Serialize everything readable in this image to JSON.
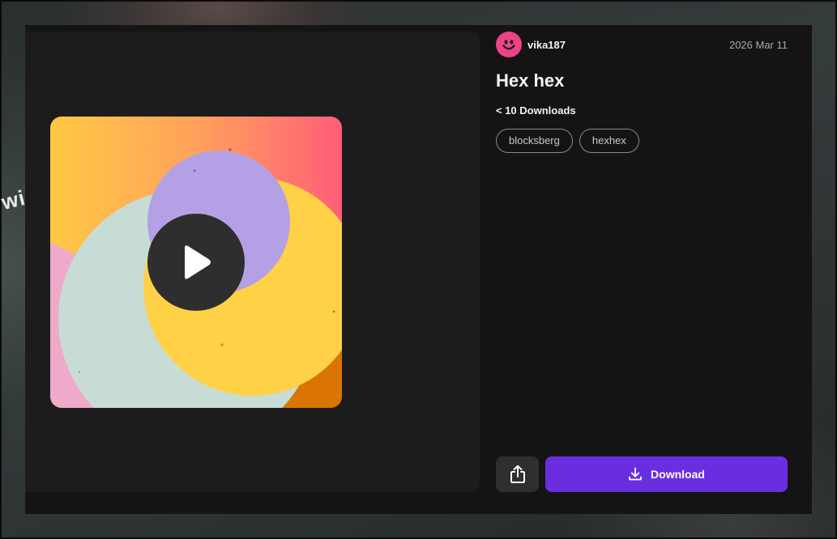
{
  "author": {
    "username": "vika187"
  },
  "post": {
    "date": "2026 Mar 11",
    "title": "Hex hex",
    "downloads": "< 10 Downloads",
    "tags": [
      "blocksberg",
      "hexhex"
    ]
  },
  "actions": {
    "download_label": "Download"
  },
  "icons": {
    "avatar": "smiley-icon",
    "play": "play-icon",
    "share": "share-icon",
    "download": "download-icon"
  },
  "colors": {
    "accent": "#6a2ee0",
    "avatar": "#ec4289",
    "artwork_palette": [
      "#ffd147",
      "#ff5e78",
      "#b4a0e4",
      "#c8dcd6",
      "#eeaac8",
      "#d97500"
    ]
  }
}
